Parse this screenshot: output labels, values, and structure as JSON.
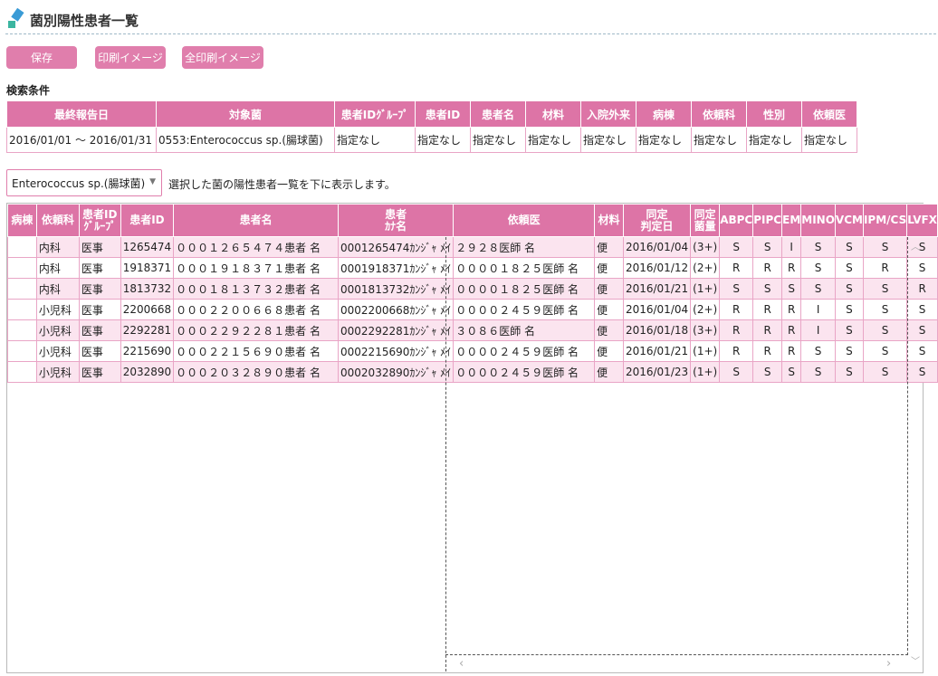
{
  "title": "菌別陽性患者一覧",
  "buttons": {
    "save": "保存",
    "print_image": "印刷イメージ",
    "print_all_image": "全印刷イメージ"
  },
  "search_conditions": {
    "label": "検索条件",
    "headers": [
      "最終報告日",
      "対象菌",
      "患者IDｸﾞﾙｰﾌﾟ",
      "患者ID",
      "患者名",
      "材料",
      "入院外来",
      "病棟",
      "依頼科",
      "性別",
      "依頼医"
    ],
    "values": [
      "2016/01/01 〜 2016/01/31",
      "0553:Enterococcus sp.(腸球菌)",
      "指定なし",
      "指定なし",
      "指定なし",
      "指定なし",
      "指定なし",
      "指定なし",
      "指定なし",
      "指定なし",
      "指定なし"
    ]
  },
  "bacteria_select": {
    "value": "Enterococcus sp.(腸球菌)",
    "note": "選択した菌の陽性患者一覧を下に表示します。"
  },
  "results": {
    "headers": [
      [
        "病棟"
      ],
      [
        "依頼科"
      ],
      [
        "患者ID",
        "ｸﾞﾙｰﾌﾟ"
      ],
      [
        "患者ID"
      ],
      [
        "患者名"
      ],
      [
        "患者",
        "ｶﾅ名"
      ],
      [
        "依頼医"
      ],
      [
        "材料"
      ],
      [
        "同定",
        "判定日"
      ],
      [
        "同定",
        "菌量"
      ],
      [
        "ABPC"
      ],
      [
        "PIPC"
      ],
      [
        "EM"
      ],
      [
        "MINO"
      ],
      [
        "VCM"
      ],
      [
        "IPM/CS"
      ],
      [
        "LVFX"
      ]
    ],
    "rows": [
      [
        "",
        "内科",
        "医事",
        "1265474",
        "０００１２６５４７４患者 名",
        "0001265474ｶﾝｼﾞｬ ﾒｲ",
        "２９２８医師 名",
        "便",
        "2016/01/04",
        "(3+)",
        "S",
        "S",
        "I",
        "S",
        "S",
        "S",
        "S"
      ],
      [
        "",
        "内科",
        "医事",
        "1918371",
        "０００１９１８３７１患者 名",
        "0001918371ｶﾝｼﾞｬ ﾒｲ",
        "００００１８２５医師 名",
        "便",
        "2016/01/12",
        "(2+)",
        "R",
        "R",
        "R",
        "S",
        "S",
        "R",
        "S"
      ],
      [
        "",
        "内科",
        "医事",
        "1813732",
        "０００１８１３７３２患者 名",
        "0001813732ｶﾝｼﾞｬ ﾒｲ",
        "００００１８２５医師 名",
        "便",
        "2016/01/21",
        "(1+)",
        "S",
        "S",
        "S",
        "S",
        "S",
        "S",
        "R"
      ],
      [
        "",
        "小児科",
        "医事",
        "2200668",
        "０００２２００６６８患者 名",
        "0002200668ｶﾝｼﾞｬ ﾒｲ",
        "００００２４５９医師 名",
        "便",
        "2016/01/04",
        "(2+)",
        "R",
        "R",
        "R",
        "I",
        "S",
        "S",
        "S"
      ],
      [
        "",
        "小児科",
        "医事",
        "2292281",
        "０００２２９２２８１患者 名",
        "0002292281ｶﾝｼﾞｬ ﾒｲ",
        "３０８６医師 名",
        "便",
        "2016/01/18",
        "(3+)",
        "R",
        "R",
        "R",
        "I",
        "S",
        "S",
        "S"
      ],
      [
        "",
        "小児科",
        "医事",
        "2215690",
        "０００２２１５６９０患者 名",
        "0002215690ｶﾝｼﾞｬ ﾒｲ",
        "００００２４５９医師 名",
        "便",
        "2016/01/21",
        "(1+)",
        "R",
        "R",
        "R",
        "S",
        "S",
        "S",
        "S"
      ],
      [
        "",
        "小児科",
        "医事",
        "2032890",
        "０００２０３２８９０患者 名",
        "0002032890ｶﾝｼﾞｬ ﾒｲ",
        "００００２４５９医師 名",
        "便",
        "2016/01/23",
        "(1+)",
        "S",
        "S",
        "S",
        "S",
        "S",
        "S",
        "S"
      ]
    ]
  },
  "colors": {
    "accent": "#dd74a6",
    "row_alt": "#fbe4ef",
    "border": "#e9a5c6"
  }
}
